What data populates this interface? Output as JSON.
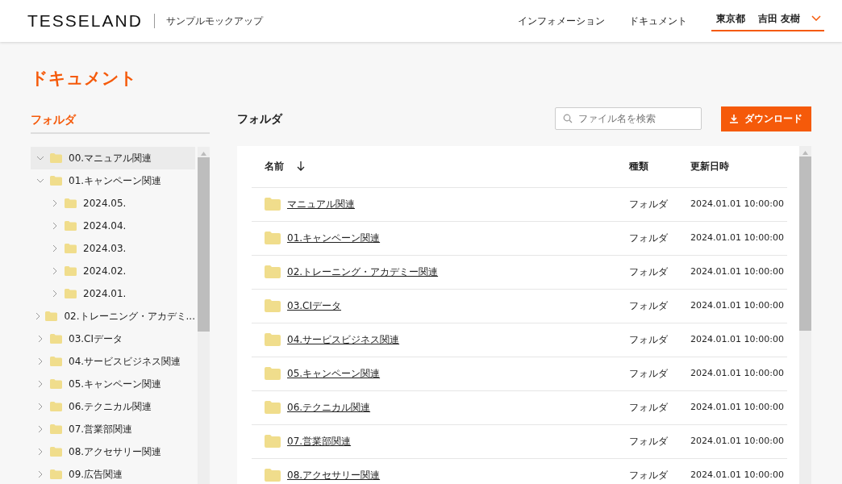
{
  "header": {
    "logo": "TESSELAND",
    "subtitle": "サンプルモックアップ",
    "nav": [
      {
        "label": "インフォメーション"
      },
      {
        "label": "ドキュメント"
      }
    ],
    "user": {
      "location": "東京都",
      "name": "吉田 友樹"
    }
  },
  "page_title": "ドキュメント",
  "sidebar": {
    "title": "フォルダ",
    "tree": [
      {
        "label": "00.マニュアル関連",
        "expanded": true,
        "selected": true
      },
      {
        "label": "01.キャンペーン関連",
        "expanded": true,
        "selected": false,
        "children": [
          {
            "label": "2024.05.",
            "expanded": false,
            "selected": false
          },
          {
            "label": "2024.04.",
            "expanded": false,
            "selected": false
          },
          {
            "label": "2024.03.",
            "expanded": false,
            "selected": false
          },
          {
            "label": "2024.02.",
            "expanded": false,
            "selected": false
          },
          {
            "label": "2024.01.",
            "expanded": false,
            "selected": false
          }
        ]
      },
      {
        "label": "02.トレーニング・アカデミ...",
        "expanded": false,
        "selected": false
      },
      {
        "label": "03.CIデータ",
        "expanded": false,
        "selected": false
      },
      {
        "label": "04.サービスビジネス関連",
        "expanded": false,
        "selected": false
      },
      {
        "label": "05.キャンペーン関連",
        "expanded": false,
        "selected": false
      },
      {
        "label": "06.テクニカル関連",
        "expanded": false,
        "selected": false
      },
      {
        "label": "07.営業部関連",
        "expanded": false,
        "selected": false
      },
      {
        "label": "08.アクセサリー関連",
        "expanded": false,
        "selected": false
      },
      {
        "label": "09.広告関連",
        "expanded": false,
        "selected": false
      }
    ]
  },
  "content": {
    "title": "フォルダ",
    "search": {
      "placeholder": "ファイル名を検索"
    },
    "download_button": "ダウンロード",
    "table": {
      "columns": [
        "名前",
        "種類",
        "更新日時"
      ],
      "rows": [
        {
          "name": "マニュアル関連",
          "type": "フォルダ",
          "updated": "2024.01.01 10:00:00"
        },
        {
          "name": "01.キャンペーン関連",
          "type": "フォルダ",
          "updated": "2024.01.01 10:00:00"
        },
        {
          "name": "02.トレーニング・アカデミー関連",
          "type": "フォルダ",
          "updated": "2024.01.01 10:00:00"
        },
        {
          "name": "03.CIデータ",
          "type": "フォルダ",
          "updated": "2024.01.01 10:00:00"
        },
        {
          "name": "04.サービスビジネス関連",
          "type": "フォルダ",
          "updated": "2024.01.01 10:00:00"
        },
        {
          "name": "05.キャンペーン関連",
          "type": "フォルダ",
          "updated": "2024.01.01 10:00:00"
        },
        {
          "name": "06.テクニカル関連",
          "type": "フォルダ",
          "updated": "2024.01.01 10:00:00"
        },
        {
          "name": "07.営業部関連",
          "type": "フォルダ",
          "updated": "2024.01.01 10:00:00"
        },
        {
          "name": "08.アクセサリー関連",
          "type": "フォルダ",
          "updated": "2024.01.01 10:00:00"
        }
      ]
    }
  }
}
